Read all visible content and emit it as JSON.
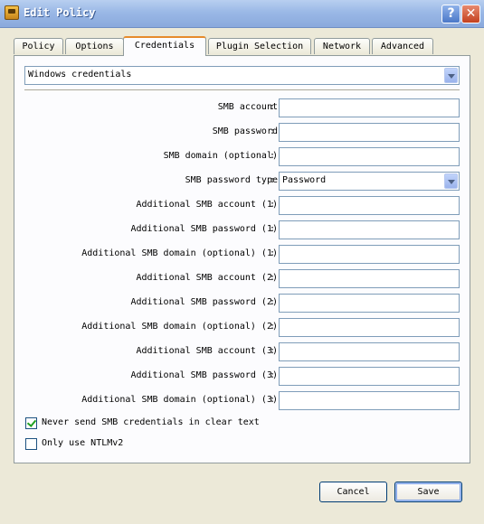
{
  "window": {
    "title": "Edit Policy",
    "help_icon": "question-mark",
    "close_icon": "x"
  },
  "tabs": [
    {
      "label": "Policy"
    },
    {
      "label": "Options"
    },
    {
      "label": "Credentials"
    },
    {
      "label": "Plugin Selection"
    },
    {
      "label": "Network"
    },
    {
      "label": "Advanced"
    }
  ],
  "active_tab": "Credentials",
  "credential_type": {
    "selected": "Windows credentials"
  },
  "fields": [
    {
      "label": "SMB account",
      "value": ""
    },
    {
      "label": "SMB password",
      "value": ""
    },
    {
      "label": "SMB domain (optional)",
      "value": ""
    },
    {
      "label": "SMB password type",
      "value": "Password",
      "type": "select"
    },
    {
      "label": "Additional SMB account (1)",
      "value": ""
    },
    {
      "label": "Additional SMB password (1)",
      "value": ""
    },
    {
      "label": "Additional SMB domain (optional) (1)",
      "value": ""
    },
    {
      "label": "Additional SMB account (2)",
      "value": ""
    },
    {
      "label": "Additional SMB password (2)",
      "value": ""
    },
    {
      "label": "Additional SMB domain (optional) (2)",
      "value": ""
    },
    {
      "label": "Additional SMB account (3)",
      "value": ""
    },
    {
      "label": "Additional SMB password (3)",
      "value": ""
    },
    {
      "label": "Additional SMB domain (optional) (3)",
      "value": ""
    }
  ],
  "label_separator": ":",
  "options": [
    {
      "label": "Never send SMB credentials in clear text",
      "checked": true
    },
    {
      "label": "Only use NTLMv2",
      "checked": false
    }
  ],
  "buttons": {
    "cancel": "Cancel",
    "save": "Save"
  },
  "colors": {
    "title_bar": "#9ab8e6",
    "active_tab_accent": "#e68b2c",
    "checkbox_check": "#21a121"
  }
}
